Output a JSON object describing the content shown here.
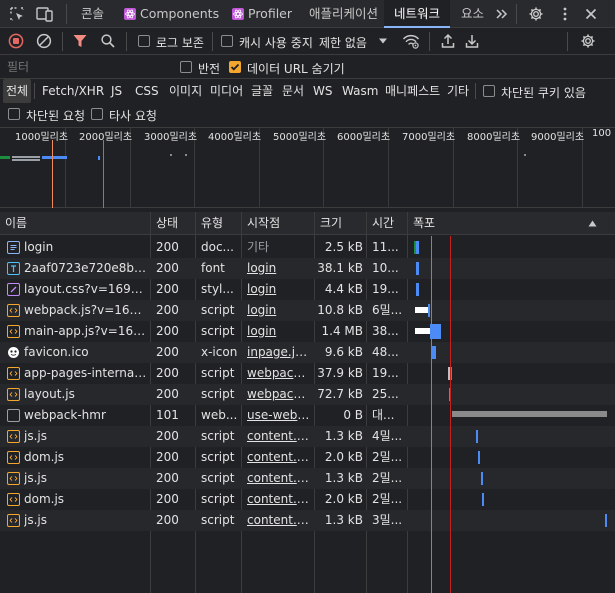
{
  "tabs": [
    {
      "label": "콘솔"
    },
    {
      "label": "Components"
    },
    {
      "label": "Profiler"
    },
    {
      "label": "애플리케이션"
    },
    {
      "label": "네트워크"
    },
    {
      "label": "요소"
    }
  ],
  "toolbar": {
    "preserve_log": "로그 보존",
    "disable_cache": "캐시 사용 중지",
    "throttle": "제한 없음"
  },
  "filter": {
    "placeholder": "필터",
    "invert": "반전",
    "hide_data_urls": "데이터 URL 숨기기"
  },
  "type_filters": [
    "전체",
    "Fetch/XHR",
    "JS",
    "CSS",
    "이미지",
    "미디어",
    "글꼴",
    "문서",
    "WS",
    "Wasm",
    "매니페스트",
    "기타"
  ],
  "extra_filters": {
    "blocked_cookies": "차단된 쿠키 있음",
    "blocked_requests": "차단된 요청",
    "third_party": "타사 요청"
  },
  "overview_ticks": [
    "1000밀리초",
    "2000밀리초",
    "3000밀리초",
    "4000밀리초",
    "5000밀리초",
    "6000밀리초",
    "7000밀리초",
    "8000밀리초",
    "9000밀리초",
    "100"
  ],
  "columns": [
    "이름",
    "상태",
    "유형",
    "시작점",
    "크기",
    "시간",
    "폭포"
  ],
  "rows": [
    {
      "name": "login",
      "status": "200",
      "type": "doc...",
      "initiator": "기타",
      "size": "2.5 kB",
      "time": "11...",
      "icon": "document-icon",
      "color": "#8ab4f8"
    },
    {
      "name": "2aaf0723e720e8b9-...",
      "status": "200",
      "type": "font",
      "initiator": "login",
      "size": "38.1 kB",
      "time": "10...",
      "icon": "font-icon",
      "color": "#4fc3f7"
    },
    {
      "name": "layout.css?v=16947...",
      "status": "200",
      "type": "styl...",
      "initiator": "login",
      "size": "4.4 kB",
      "time": "19...",
      "icon": "stylesheet-icon",
      "color": "#c58af9"
    },
    {
      "name": "webpack.js?v=1694...",
      "status": "200",
      "type": "script",
      "initiator": "login",
      "size": "10.8 kB",
      "time": "6밀...",
      "icon": "script-icon",
      "color": "#f4a72e"
    },
    {
      "name": "main-app.js?v=1694...",
      "status": "200",
      "type": "script",
      "initiator": "login",
      "size": "1.4 MB",
      "time": "38...",
      "icon": "script-icon",
      "color": "#f4a72e"
    },
    {
      "name": "favicon.ico",
      "status": "200",
      "type": "x-icon",
      "initiator": "inpage.js:1",
      "size": "9.6 kB",
      "time": "48...",
      "icon": "image-icon",
      "color": "#e3e3e3"
    },
    {
      "name": "app-pages-internals.js",
      "status": "200",
      "type": "script",
      "initiator": "webpack....",
      "size": "37.9 kB",
      "time": "19...",
      "icon": "script-icon",
      "color": "#f4a72e"
    },
    {
      "name": "layout.js",
      "status": "200",
      "type": "script",
      "initiator": "webpack....",
      "size": "72.7 kB",
      "time": "25...",
      "icon": "script-icon",
      "color": "#f4a72e"
    },
    {
      "name": "webpack-hmr",
      "status": "101",
      "type": "web...",
      "initiator": "use-webs...",
      "size": "0 B",
      "time": "대...",
      "icon": "websocket-icon",
      "color": "#9aa0a6"
    },
    {
      "name": "js.js",
      "status": "200",
      "type": "script",
      "initiator": "content.js...",
      "size": "1.3 kB",
      "time": "4밀...",
      "icon": "script-icon",
      "color": "#f4a72e"
    },
    {
      "name": "dom.js",
      "status": "200",
      "type": "script",
      "initiator": "content.js...",
      "size": "2.0 kB",
      "time": "2밀...",
      "icon": "script-icon",
      "color": "#f4a72e"
    },
    {
      "name": "js.js",
      "status": "200",
      "type": "script",
      "initiator": "content.js...",
      "size": "1.3 kB",
      "time": "2밀...",
      "icon": "script-icon",
      "color": "#f4a72e"
    },
    {
      "name": "dom.js",
      "status": "200",
      "type": "script",
      "initiator": "content.js...",
      "size": "2.0 kB",
      "time": "2밀...",
      "icon": "script-icon",
      "color": "#f4a72e"
    },
    {
      "name": "js.js",
      "status": "200",
      "type": "script",
      "initiator": "content.js...",
      "size": "1.3 kB",
      "time": "3밀...",
      "icon": "script-icon",
      "color": "#f4a72e"
    }
  ],
  "colors": {
    "accent": "#8ab4f8",
    "record": "#e46962",
    "filter": "#f28b82",
    "checkbox": "#f4a72e"
  }
}
